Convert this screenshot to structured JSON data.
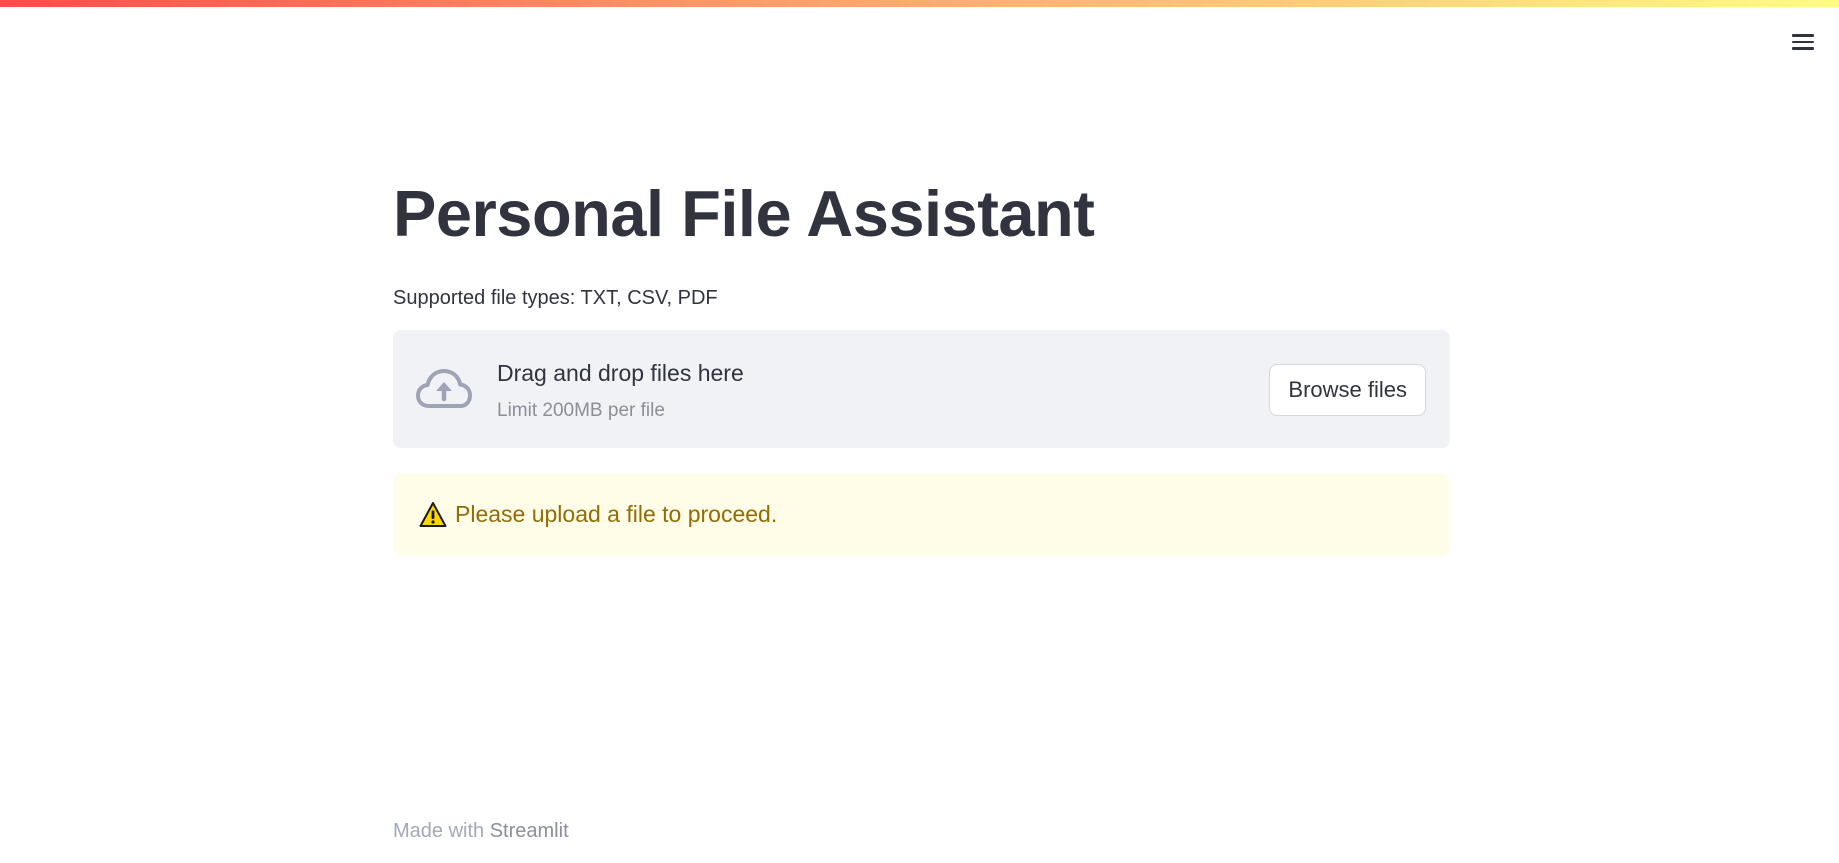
{
  "app": {
    "menu_icon": "hamburger-menu-icon",
    "accent_gradient": [
      "#ff4b4b",
      "#fffd80"
    ]
  },
  "main": {
    "title": "Personal File Assistant",
    "uploader": {
      "label": "Supported file types: TXT, CSV, PDF",
      "icon": "cloud-upload-icon",
      "drop_text": "Drag and drop files here",
      "limit_text": "Limit 200MB per file",
      "browse_label": "Browse files"
    },
    "warning": {
      "icon": "warning-triangle-icon",
      "text": "Please upload a file to proceed.",
      "background": "#fffce7",
      "color": "#926c05"
    }
  },
  "footer": {
    "prefix": "Made with",
    "link": "Streamlit"
  }
}
